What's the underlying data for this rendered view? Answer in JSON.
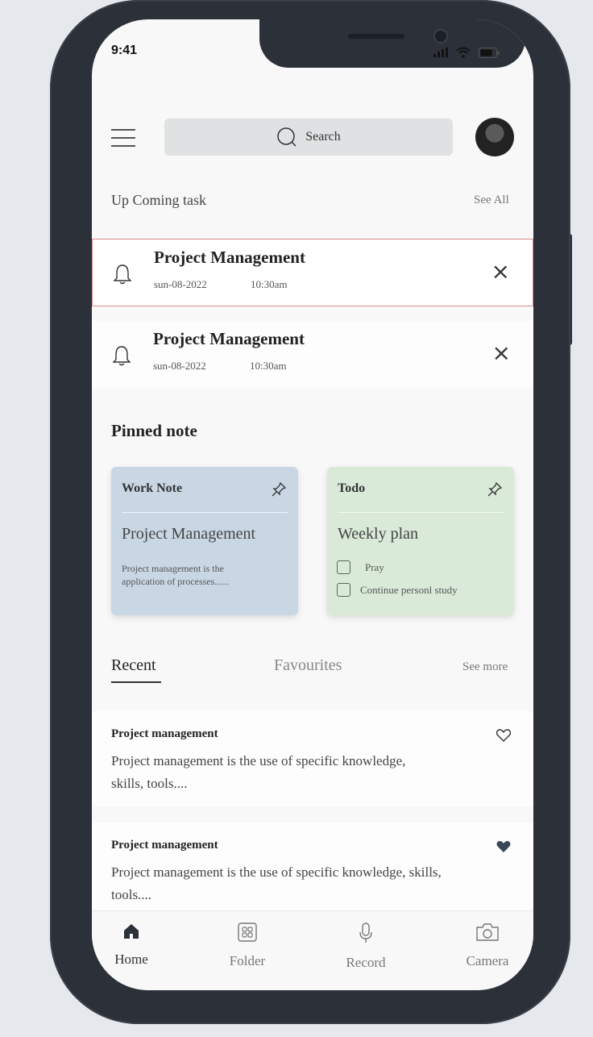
{
  "status_bar": {
    "time": "9:41"
  },
  "header": {
    "search_placeholder": "Search"
  },
  "upcoming": {
    "title": "Up Coming task",
    "see_all": "See All",
    "tasks": [
      {
        "title": "Project Management",
        "date": "sun-08-2022",
        "time": "10:30am",
        "close": "×"
      },
      {
        "title": "Project Management",
        "date": "sun-08-2022",
        "time": "10:30am",
        "close": "×"
      }
    ]
  },
  "pinned": {
    "title": "Pinned note",
    "cards": [
      {
        "label": "Work Note",
        "title": "Project Management",
        "body_line1": "Project management is the",
        "body_line2": "application of processes......",
        "color": "#c9d7e4"
      },
      {
        "label": "Todo",
        "title": "Weekly plan",
        "items": [
          "Pray",
          "Continue personl study"
        ],
        "color": "#d9ead9"
      }
    ]
  },
  "tabs": {
    "recent": "Recent",
    "favourites": "Favourites",
    "see_more": "See more"
  },
  "notes": [
    {
      "title": "Project management",
      "line1": "Project management is the use of specific knowledge,",
      "line2": "skills, tools....",
      "favourite": false
    },
    {
      "title": "Project management",
      "line1": "Project management is the use of specific knowledge, skills,",
      "line2": "tools....",
      "favourite": true
    }
  ],
  "bottom_nav": [
    {
      "label": "Home",
      "icon": "home-icon",
      "active": true
    },
    {
      "label": "Folder",
      "icon": "folder-grid-icon",
      "active": false
    },
    {
      "label": "Record",
      "icon": "microphone-icon",
      "active": false
    },
    {
      "label": "Camera",
      "icon": "camera-icon",
      "active": false
    }
  ]
}
